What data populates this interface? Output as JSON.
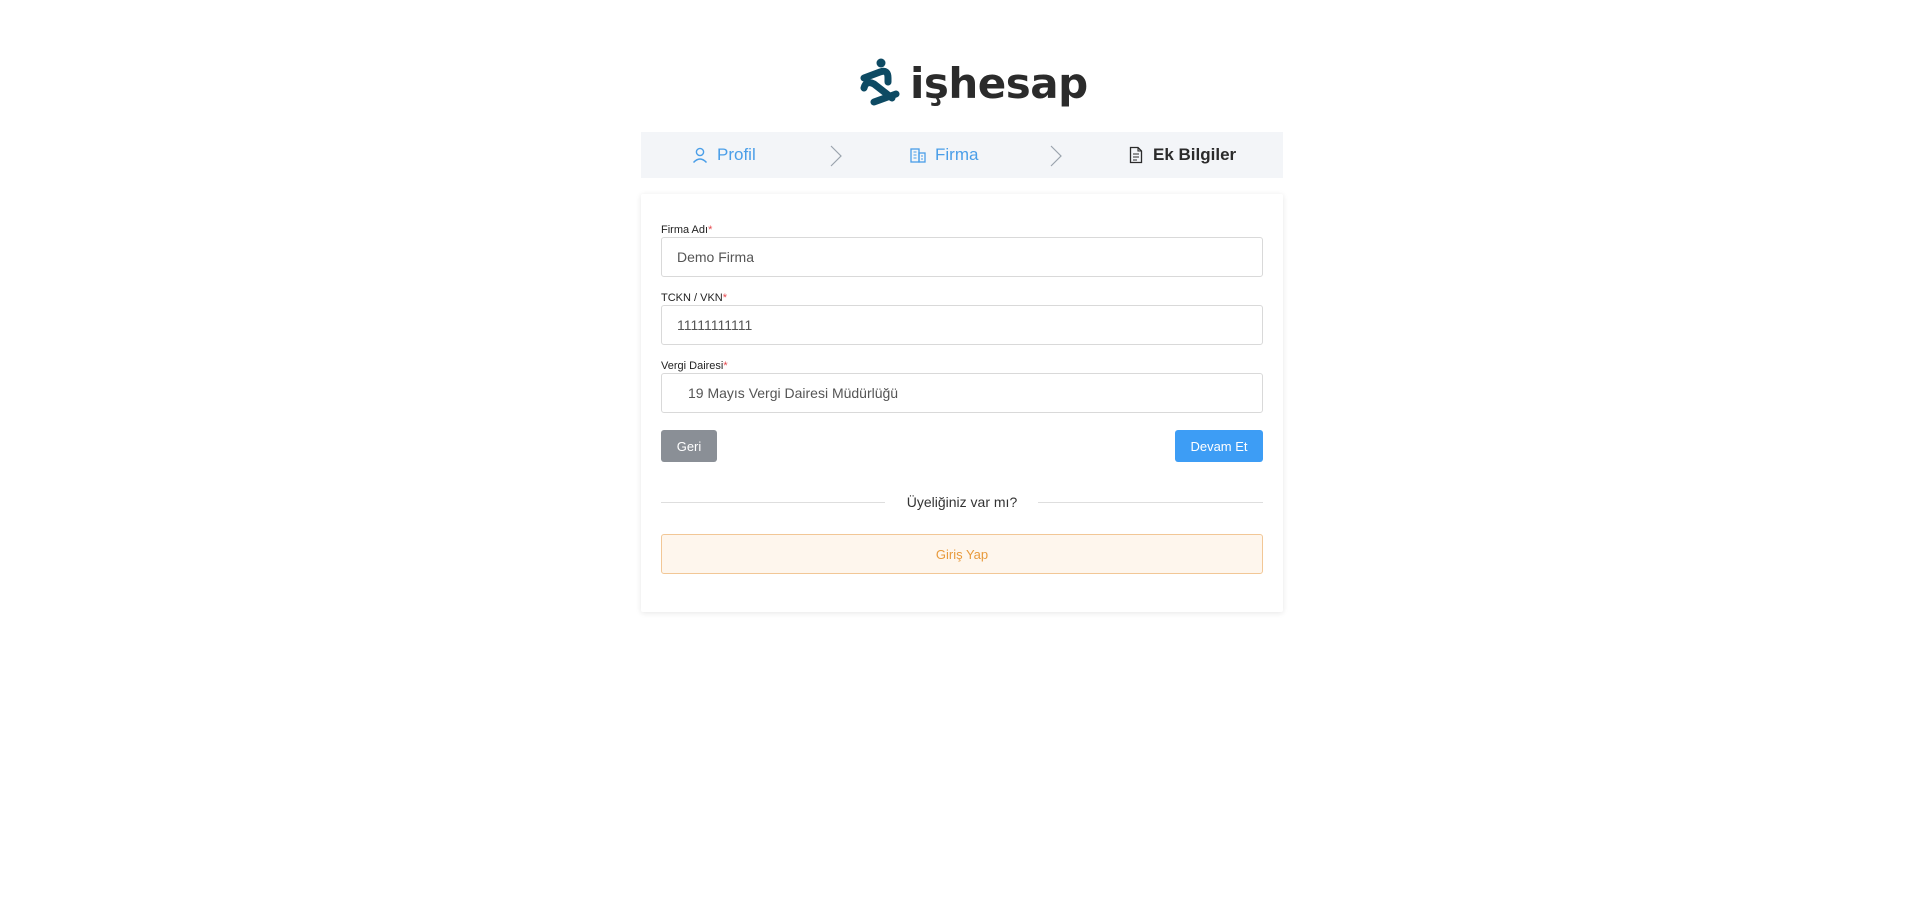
{
  "brand": {
    "name": "işhesap"
  },
  "steps": [
    {
      "label": "Profil",
      "icon": "user-icon",
      "state": "done"
    },
    {
      "label": "Firma",
      "icon": "building-icon",
      "state": "done"
    },
    {
      "label": "Ek Bilgiler",
      "icon": "document-icon",
      "state": "active"
    }
  ],
  "form": {
    "company_name": {
      "label": "Firma Adı",
      "required_mark": "*",
      "value": "Demo Firma"
    },
    "tax_id": {
      "label": "TCKN / VKN",
      "required_mark": "*",
      "value": "11111111111"
    },
    "tax_office": {
      "label": "Vergi Dairesi",
      "required_mark": "*",
      "value": "19 Mayıs Vergi Dairesi Müdürlüğü"
    }
  },
  "actions": {
    "back_label": "Geri",
    "next_label": "Devam Et"
  },
  "membership": {
    "question": "Üyeliğiniz var mı?",
    "login_label": "Giriş Yap"
  },
  "colors": {
    "primary": "#3d9df5",
    "step_link": "#4a9ee8",
    "back_button": "#8a8f96",
    "login_text": "#e89a3c",
    "login_bg": "#fef6ed",
    "required": "#e5484d",
    "logo_mark": "#0d4a63"
  }
}
